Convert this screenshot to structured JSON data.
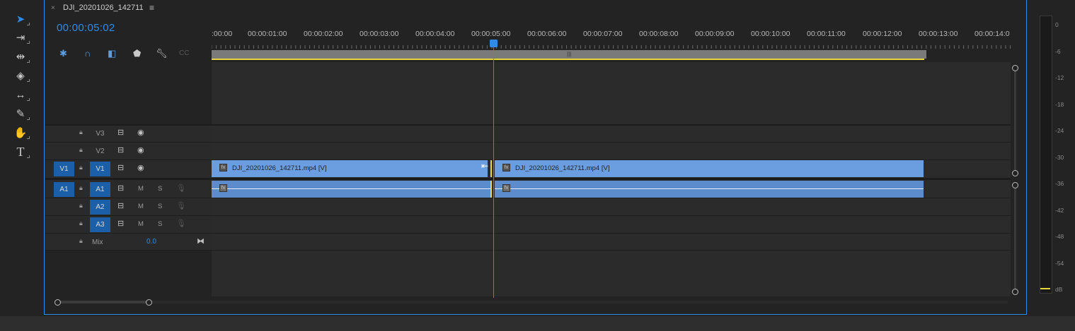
{
  "sequence": {
    "tab_close": "×",
    "title": "DJI_20201026_142711",
    "menu_icon": "≡",
    "timecode": "00:00:05:02"
  },
  "tools": [
    "selection-tool",
    "track-select-tool",
    "ripple-edit-tool",
    "razor-tool",
    "slip-tool",
    "pen-tool",
    "hand-tool",
    "type-tool"
  ],
  "ruler_labels": [
    ":00:00",
    "00:00:01:00",
    "00:00:02:00",
    "00:00:03:00",
    "00:00:04:00",
    "00:00:05:00",
    "00:00:06:00",
    "00:00:07:00",
    "00:00:08:00",
    "00:00:09:00",
    "00:00:10:00",
    "00:00:11:00",
    "00:00:12:00",
    "00:00:13:00",
    "00:00:14:0"
  ],
  "tracks": {
    "v3": {
      "name": "V3"
    },
    "v2": {
      "name": "V2"
    },
    "v1": {
      "target": "V1",
      "name": "V1"
    },
    "a1": {
      "target": "A1",
      "name": "A1",
      "m": "M",
      "s": "S"
    },
    "a2": {
      "name": "A2",
      "m": "M",
      "s": "S"
    },
    "a3": {
      "name": "A3",
      "m": "M",
      "s": "S"
    },
    "mix": {
      "name": "Mix",
      "value": "0.0"
    }
  },
  "clips": {
    "v1_left": "DJI_20201026_142711.mp4 [V]",
    "v1_right": "DJI_20201026_142711.mp4 [V]",
    "fx": "fx"
  },
  "meter_labels": [
    "0",
    "-6",
    "-12",
    "-18",
    "-24",
    "-30",
    "-36",
    "-42",
    "-48",
    "-54",
    "dB"
  ],
  "colors": {
    "accent": "#2d8ceb",
    "video_clip": "#6a9ee0",
    "audio_clip": "#5d8ccc",
    "work_area": "#e6d83a"
  }
}
